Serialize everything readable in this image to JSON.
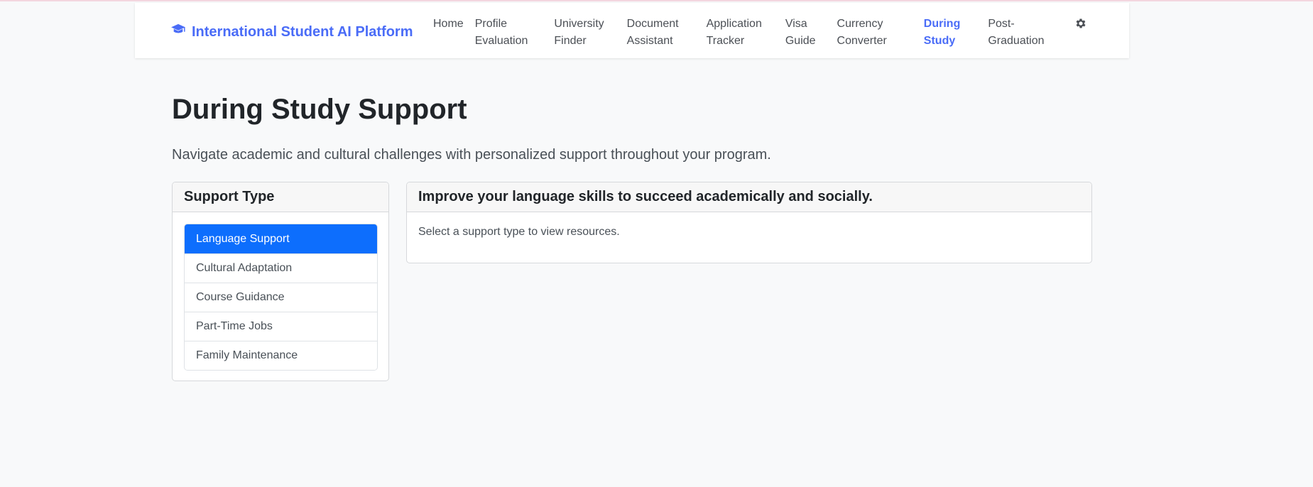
{
  "brand": {
    "title": "International Student AI Platform",
    "icon": "graduation-cap-icon",
    "color": "#4a6cf7"
  },
  "nav": {
    "items": [
      {
        "label": "Home",
        "active": false
      },
      {
        "label": "Profile\nEvaluation",
        "active": false
      },
      {
        "label": "University\nFinder",
        "active": false
      },
      {
        "label": "Document\nAssistant",
        "active": false
      },
      {
        "label": "Application\nTracker",
        "active": false
      },
      {
        "label": "Visa\nGuide",
        "active": false
      },
      {
        "label": "Currency\nConverter",
        "active": false
      },
      {
        "label": "During\nStudy",
        "active": true
      },
      {
        "label": "Post-\nGraduation",
        "active": false
      }
    ],
    "settings_icon": "gear-icon"
  },
  "page": {
    "title": "During Study Support",
    "subtitle": "Navigate academic and cultural challenges with personalized support throughout your program."
  },
  "support_panel": {
    "header": "Support Type",
    "items": [
      {
        "label": "Language Support",
        "active": true
      },
      {
        "label": "Cultural Adaptation",
        "active": false
      },
      {
        "label": "Course Guidance",
        "active": false
      },
      {
        "label": "Part-Time Jobs",
        "active": false
      },
      {
        "label": "Family Maintenance",
        "active": false
      }
    ],
    "active_color": "#0d6efd"
  },
  "resources_panel": {
    "header": "Improve your language skills to succeed academically and socially.",
    "body": "Select a support type to view resources."
  }
}
